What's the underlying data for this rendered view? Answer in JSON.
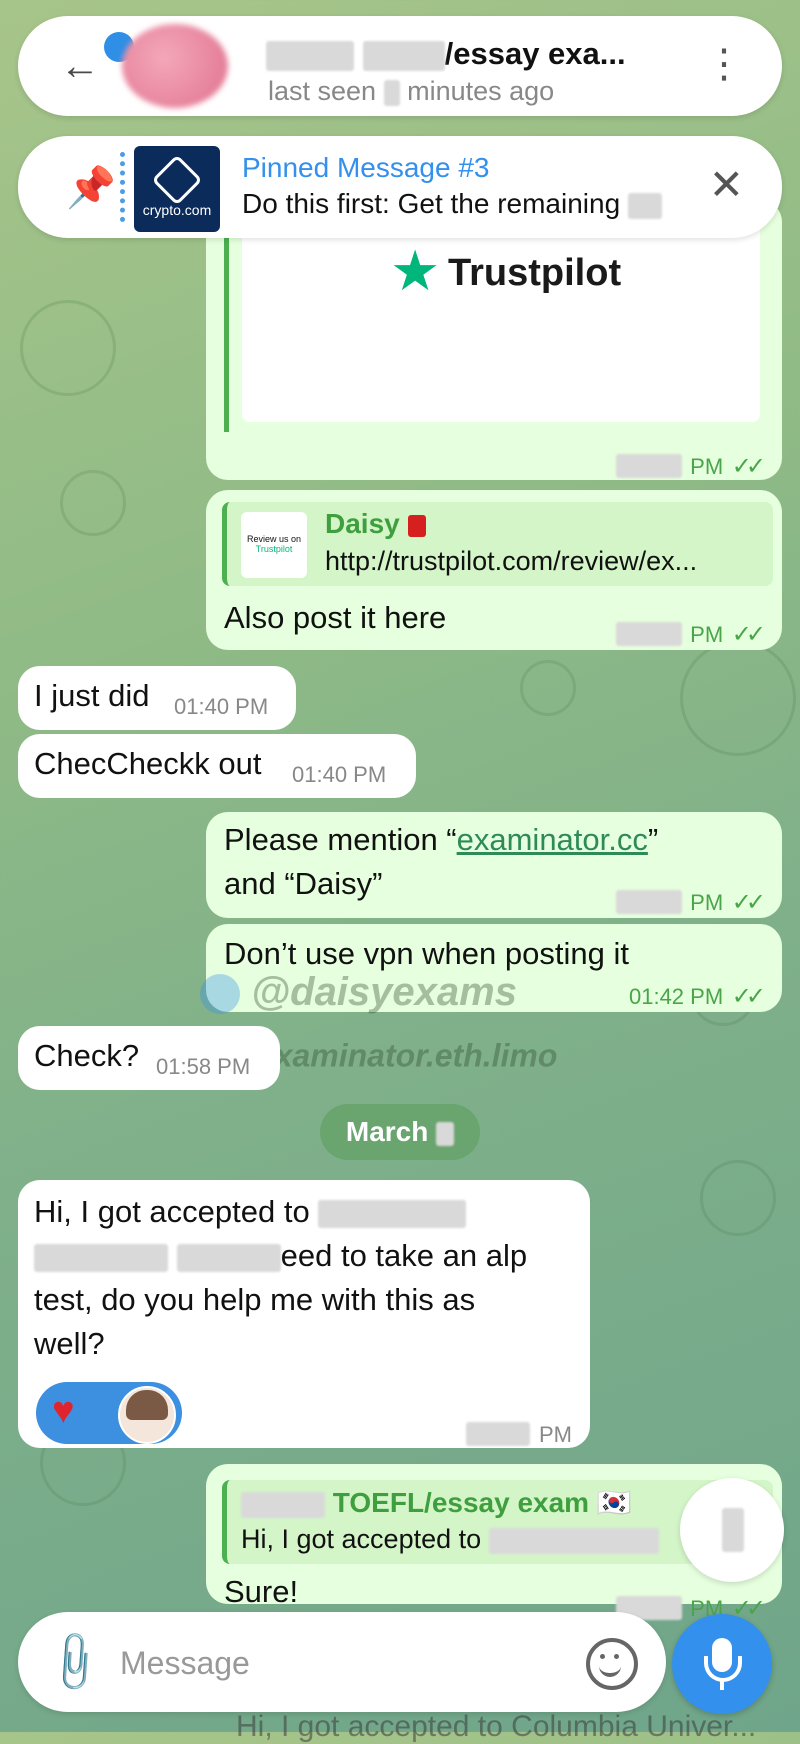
{
  "header": {
    "title": "/essay exa...",
    "subtitle_prefix": "last seen",
    "subtitle_suffix": "minutes ago"
  },
  "pinned": {
    "title": "Pinned Message #3",
    "text": "Do this first: Get the remaining",
    "thumb_label": "crypto.com"
  },
  "messages": {
    "trustpilot_card_brand": "Trustpilot",
    "trustpilot_time": "PM",
    "daisy_reply_name": "Daisy",
    "daisy_reply_thumb_line1": "Review us on",
    "daisy_reply_thumb_line2": "Trustpilot",
    "daisy_reply_link": "http://trustpilot.com/review/ex...",
    "daisy_text": "Also post it here",
    "daisy_time": "PM",
    "in1_text": "I just did",
    "in1_time": "01:40 PM",
    "in2_text": "ChecCheckk out",
    "in2_time": "01:40 PM",
    "out3_text_1": "Please mention “",
    "out3_link": "examinator.cc",
    "out3_text_2": "”",
    "out3_text_3": "and “Daisy”",
    "out3_time": "PM",
    "out4_text": "Don’t use vpn when posting it",
    "out4_time": "01:42 PM",
    "in3_text": "Check?",
    "in3_time": "01:58 PM",
    "date_pill": "March",
    "in4_line1": "Hi, I got accepted to",
    "in4_line2_tail": "eed to take an alp",
    "in4_line3": "test, do you help me with this as",
    "in4_line4": "well?",
    "in4_time": "PM",
    "reply_name": "TOEFL/essay exam 🇰🇷",
    "reply_text": "Hi, I got accepted to",
    "out5_text": "Sure!",
    "out5_time": "PM"
  },
  "watermarks": {
    "handle": "@daisyexams",
    "site": "examinator.eth.limo"
  },
  "bottom_peek": "Hi, I got accepted to Columbia Univer...",
  "composer": {
    "placeholder": "Message"
  },
  "colors": {
    "accent": "#3390ec",
    "outgoing_bubble": "#e6ffde",
    "incoming_bubble": "#ffffff",
    "time_green": "#4aa54a",
    "reaction_heart": "#e0242d"
  },
  "icons": [
    "back-arrow-icon",
    "more-vertical-icon",
    "pin-icon",
    "close-icon",
    "star-icon",
    "double-check-icon",
    "globe-icon",
    "telegram-icon",
    "heart-icon",
    "attach-icon",
    "emoji-icon",
    "mic-icon"
  ]
}
